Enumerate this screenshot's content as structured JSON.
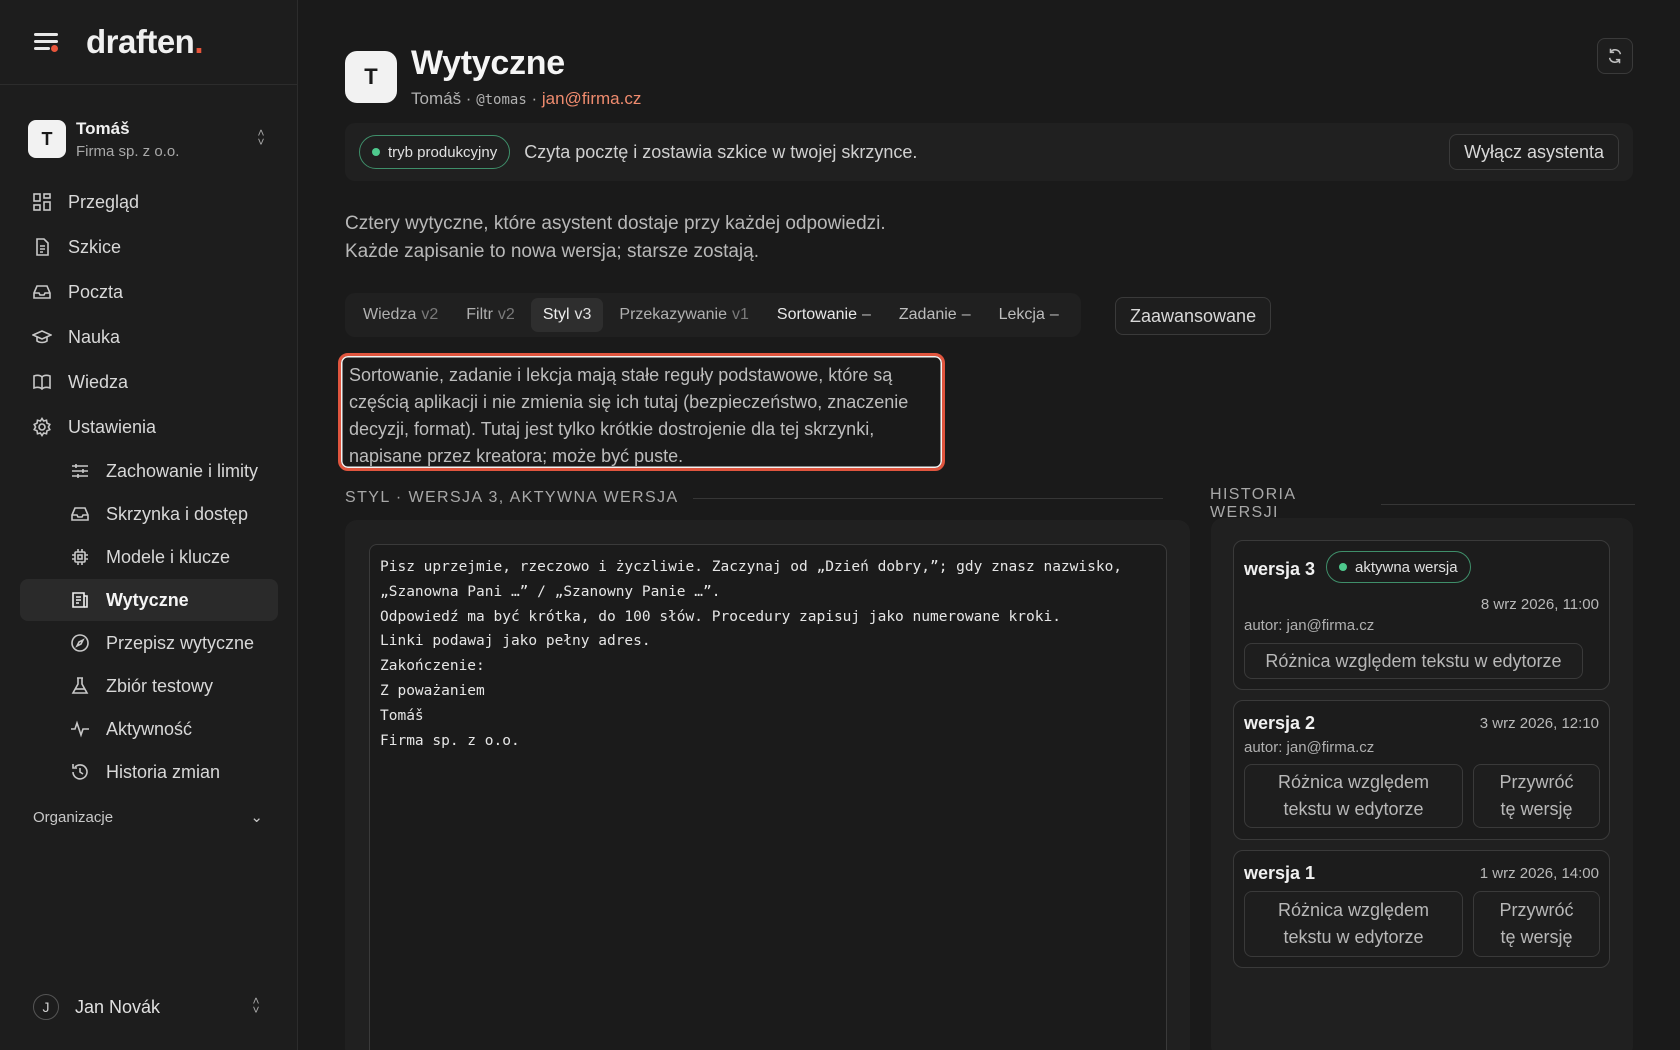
{
  "brand": {
    "name": "draften",
    "accent": "#e8553b"
  },
  "account": {
    "initial": "T",
    "name": "Tomáš",
    "company": "Firma sp. z o.o."
  },
  "nav": {
    "items": [
      {
        "label": "Przegląd",
        "icon": "dashboard-icon"
      },
      {
        "label": "Szkice",
        "icon": "document-icon"
      },
      {
        "label": "Poczta",
        "icon": "inbox-icon"
      },
      {
        "label": "Nauka",
        "icon": "graduation-cap-icon"
      },
      {
        "label": "Wiedza",
        "icon": "book-icon"
      },
      {
        "label": "Ustawienia",
        "icon": "gear-icon"
      }
    ],
    "sub_items": [
      {
        "label": "Zachowanie i limity",
        "icon": "sliders-icon"
      },
      {
        "label": "Skrzynka i dostęp",
        "icon": "inbox-icon"
      },
      {
        "label": "Modele i klucze",
        "icon": "chip-icon"
      },
      {
        "label": "Wytyczne",
        "icon": "guidelines-icon",
        "active": true
      },
      {
        "label": "Przepisz wytyczne",
        "icon": "compass-icon"
      },
      {
        "label": "Zbiór testowy",
        "icon": "flask-icon"
      },
      {
        "label": "Aktywność",
        "icon": "activity-icon"
      },
      {
        "label": "Historia zmian",
        "icon": "history-icon"
      }
    ],
    "organizations": "Organizacje"
  },
  "user": {
    "initial": "J",
    "name": "Jan Novák"
  },
  "header": {
    "initial": "T",
    "title": "Wytyczne",
    "meta_name": "Tomáš · ",
    "meta_handle": "@tomas",
    "meta_sep": " · ",
    "meta_email": "jan@firma.cz"
  },
  "status": {
    "mode": "tryb produkcyjny",
    "description": "Czyta pocztę i zostawia szkice w twojej skrzynce.",
    "disable_button": "Wyłącz asystenta"
  },
  "intro": {
    "line1": "Cztery wytyczne, które asystent dostaje przy każdej odpowiedzi.",
    "line2": "Każde zapisanie to nowa wersja; starsze zostają."
  },
  "tabs": [
    {
      "label": "Wiedza",
      "version": "v2"
    },
    {
      "label": "Filtr",
      "version": "v2"
    },
    {
      "label": "Styl",
      "version": "v3",
      "active": true
    },
    {
      "label": "Przekazywanie",
      "version": "v1"
    },
    {
      "label": "Sortowanie",
      "version": "–"
    },
    {
      "label": "Zadanie",
      "version": "–"
    },
    {
      "label": "Lekcja",
      "version": "–"
    }
  ],
  "advanced_button": "Zaawansowane",
  "note": "Sortowanie, zadanie i lekcja mają stałe reguły podstawowe, które są częścią aplikacji i nie zmienia się ich tutaj (bezpieczeństwo, znaczenie decyzji, format). Tutaj jest tylko krótkie dostrojenie dla tej skrzynki, napisane przez kreatora; może być puste.",
  "editor": {
    "title": "STYL · WERSJA 3, AKTYWNA WERSJA",
    "content": "Pisz uprzejmie, rzeczowo i życzliwie. Zaczynaj od „Dzień dobry,”; gdy znasz nazwisko,\n„Szanowna Pani …” / „Szanowny Panie …”.\nOdpowiedź ma być krótka, do 100 słów. Procedury zapisuj jako numerowane kroki.\nLinki podawaj jako pełny adres.\nZakończenie:\nZ poważaniem\nTomáš\nFirma sp. z o.o."
  },
  "history": {
    "title": "HISTORIA WERSJI",
    "versions": [
      {
        "label": "wersja 3",
        "badge": "aktywna wersja",
        "date": "8 wrz 2026, 11:00",
        "author": "autor: jan@firma.cz",
        "diff": "Różnica względem tekstu w edytorze"
      },
      {
        "label": "wersja 2",
        "date": "3 wrz 2026, 12:10",
        "author": "autor: jan@firma.cz",
        "diff": "Różnica względem tekstu w edytorze",
        "restore": "Przywróć tę wersję"
      },
      {
        "label": "wersja 1",
        "date": "1 wrz 2026, 14:00",
        "diff": "Różnica względem tekstu w edytorze",
        "restore": "Przywróć tę wersję"
      }
    ]
  },
  "colors": {
    "background": "#1a1a1a",
    "accent_orange": "#ef8b6e",
    "active_green": "#4ec98d",
    "highlight_red": "#e0553e"
  }
}
